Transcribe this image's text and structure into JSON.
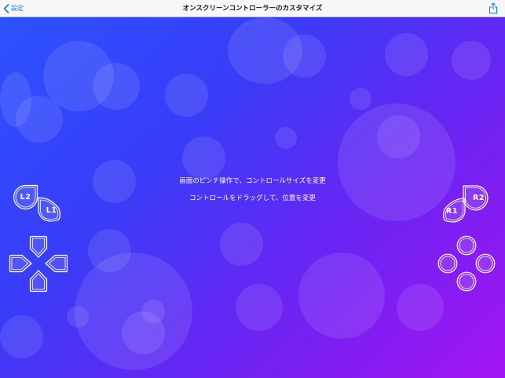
{
  "nav": {
    "back_label": "設定",
    "title": "オンスクリーンコントローラーのカスタマイズ"
  },
  "instructions": {
    "line1": "画面のピンチ操作で、コントロールサイズを変更",
    "line2": "コントロールをドラッグして、位置を変更"
  },
  "controls": {
    "l2": "L2",
    "l1": "L1",
    "r2": "R2",
    "r1": "R1"
  },
  "colors": {
    "accent": "#0a7aff",
    "gradient_start": "#2b52ff",
    "gradient_end": "#a414f2"
  }
}
